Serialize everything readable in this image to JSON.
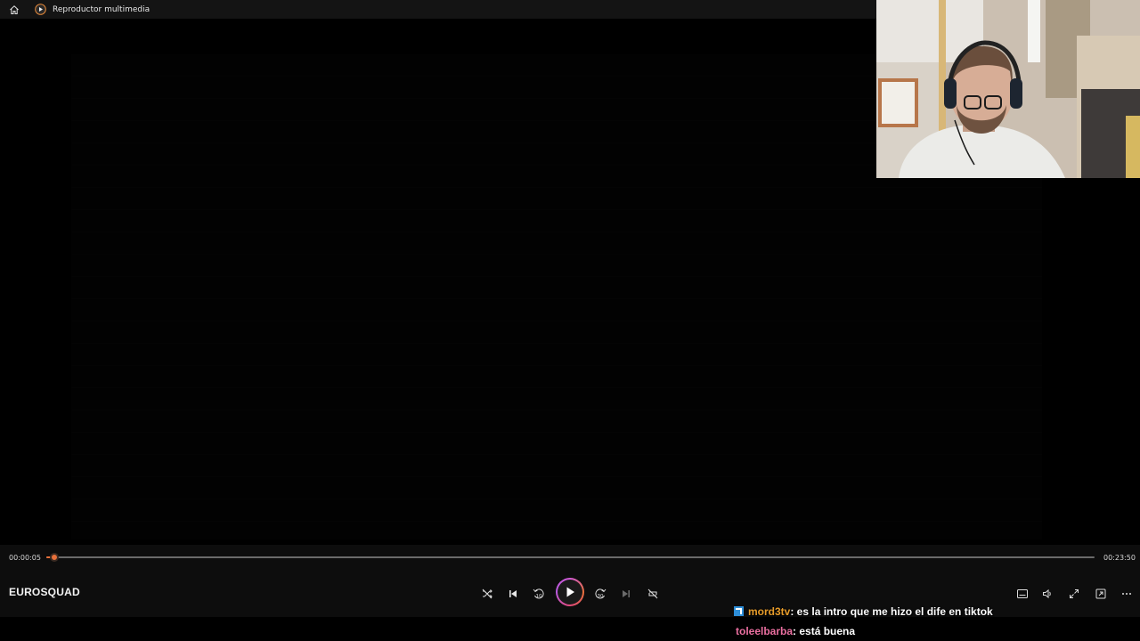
{
  "titlebar": {
    "title": "Reproductor multimedia"
  },
  "player": {
    "current_time": "00:00:05",
    "total_time": "00:23:50",
    "progress": 0.0035,
    "media_title": "EUROSQUAD",
    "accent_color": "#e8703a"
  },
  "controls": {
    "icons": [
      "shuffle-icon",
      "previous-icon",
      "rewind-10-icon",
      "play-icon",
      "forward-30-icon",
      "next-icon",
      "repeat-off-icon",
      "subtitles-icon",
      "volume-icon",
      "fullscreen-icon",
      "miniplayer-icon",
      "more-icon"
    ],
    "rewind_label": "10",
    "forward_label": "30"
  },
  "chat": {
    "messages": [
      {
        "user": "mord3tv",
        "text": ": es la intro que me hizo el dife en tiktok",
        "user_color": "#e79c2a",
        "badge": true
      },
      {
        "user": "toleelbarba",
        "text": ": está buena",
        "user_color": "#ea6fa0",
        "badge": false
      }
    ]
  }
}
